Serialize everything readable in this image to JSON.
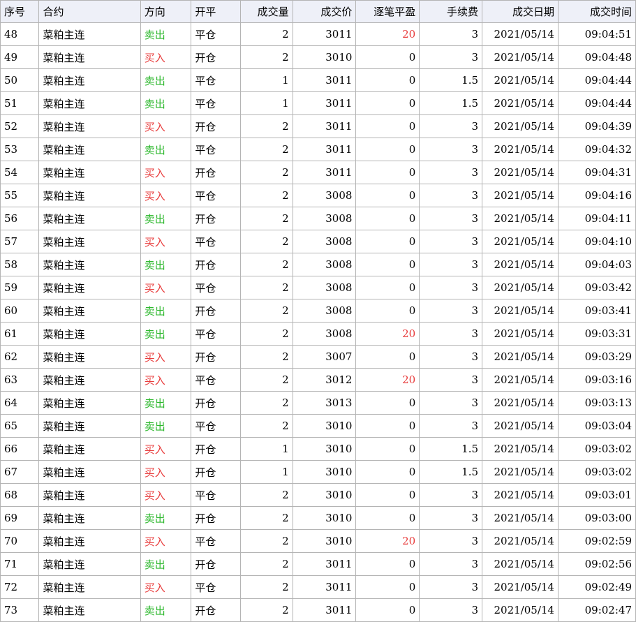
{
  "headers": [
    "序号",
    "合约",
    "方向",
    "开平",
    "成交量",
    "成交价",
    "逐笔平盈",
    "手续费",
    "成交日期",
    "成交时间"
  ],
  "colors": {
    "sell": "#2db82d",
    "buy": "#e83c3c",
    "profit_positive": "#e83c3c",
    "header_bg": "#eef0f8",
    "grid": "#b4b4b4"
  },
  "rows": [
    {
      "seq": "48",
      "contract": "菜粕主连",
      "direction": "卖出",
      "offset": "平仓",
      "volume": "2",
      "price": "3011",
      "pnl": "20",
      "fee": "3",
      "date": "2021/05/14",
      "time": "09:04:51"
    },
    {
      "seq": "49",
      "contract": "菜粕主连",
      "direction": "买入",
      "offset": "开仓",
      "volume": "2",
      "price": "3010",
      "pnl": "0",
      "fee": "3",
      "date": "2021/05/14",
      "time": "09:04:48"
    },
    {
      "seq": "50",
      "contract": "菜粕主连",
      "direction": "卖出",
      "offset": "平仓",
      "volume": "1",
      "price": "3011",
      "pnl": "0",
      "fee": "1.5",
      "date": "2021/05/14",
      "time": "09:04:44"
    },
    {
      "seq": "51",
      "contract": "菜粕主连",
      "direction": "卖出",
      "offset": "平仓",
      "volume": "1",
      "price": "3011",
      "pnl": "0",
      "fee": "1.5",
      "date": "2021/05/14",
      "time": "09:04:44"
    },
    {
      "seq": "52",
      "contract": "菜粕主连",
      "direction": "买入",
      "offset": "开仓",
      "volume": "2",
      "price": "3011",
      "pnl": "0",
      "fee": "3",
      "date": "2021/05/14",
      "time": "09:04:39"
    },
    {
      "seq": "53",
      "contract": "菜粕主连",
      "direction": "卖出",
      "offset": "平仓",
      "volume": "2",
      "price": "3011",
      "pnl": "0",
      "fee": "3",
      "date": "2021/05/14",
      "time": "09:04:32"
    },
    {
      "seq": "54",
      "contract": "菜粕主连",
      "direction": "买入",
      "offset": "开仓",
      "volume": "2",
      "price": "3011",
      "pnl": "0",
      "fee": "3",
      "date": "2021/05/14",
      "time": "09:04:31"
    },
    {
      "seq": "55",
      "contract": "菜粕主连",
      "direction": "买入",
      "offset": "平仓",
      "volume": "2",
      "price": "3008",
      "pnl": "0",
      "fee": "3",
      "date": "2021/05/14",
      "time": "09:04:16"
    },
    {
      "seq": "56",
      "contract": "菜粕主连",
      "direction": "卖出",
      "offset": "开仓",
      "volume": "2",
      "price": "3008",
      "pnl": "0",
      "fee": "3",
      "date": "2021/05/14",
      "time": "09:04:11"
    },
    {
      "seq": "57",
      "contract": "菜粕主连",
      "direction": "买入",
      "offset": "平仓",
      "volume": "2",
      "price": "3008",
      "pnl": "0",
      "fee": "3",
      "date": "2021/05/14",
      "time": "09:04:10"
    },
    {
      "seq": "58",
      "contract": "菜粕主连",
      "direction": "卖出",
      "offset": "开仓",
      "volume": "2",
      "price": "3008",
      "pnl": "0",
      "fee": "3",
      "date": "2021/05/14",
      "time": "09:04:03"
    },
    {
      "seq": "59",
      "contract": "菜粕主连",
      "direction": "买入",
      "offset": "平仓",
      "volume": "2",
      "price": "3008",
      "pnl": "0",
      "fee": "3",
      "date": "2021/05/14",
      "time": "09:03:42"
    },
    {
      "seq": "60",
      "contract": "菜粕主连",
      "direction": "卖出",
      "offset": "开仓",
      "volume": "2",
      "price": "3008",
      "pnl": "0",
      "fee": "3",
      "date": "2021/05/14",
      "time": "09:03:41"
    },
    {
      "seq": "61",
      "contract": "菜粕主连",
      "direction": "卖出",
      "offset": "平仓",
      "volume": "2",
      "price": "3008",
      "pnl": "20",
      "fee": "3",
      "date": "2021/05/14",
      "time": "09:03:31"
    },
    {
      "seq": "62",
      "contract": "菜粕主连",
      "direction": "买入",
      "offset": "开仓",
      "volume": "2",
      "price": "3007",
      "pnl": "0",
      "fee": "3",
      "date": "2021/05/14",
      "time": "09:03:29"
    },
    {
      "seq": "63",
      "contract": "菜粕主连",
      "direction": "买入",
      "offset": "平仓",
      "volume": "2",
      "price": "3012",
      "pnl": "20",
      "fee": "3",
      "date": "2021/05/14",
      "time": "09:03:16"
    },
    {
      "seq": "64",
      "contract": "菜粕主连",
      "direction": "卖出",
      "offset": "开仓",
      "volume": "2",
      "price": "3013",
      "pnl": "0",
      "fee": "3",
      "date": "2021/05/14",
      "time": "09:03:13"
    },
    {
      "seq": "65",
      "contract": "菜粕主连",
      "direction": "卖出",
      "offset": "平仓",
      "volume": "2",
      "price": "3010",
      "pnl": "0",
      "fee": "3",
      "date": "2021/05/14",
      "time": "09:03:04"
    },
    {
      "seq": "66",
      "contract": "菜粕主连",
      "direction": "买入",
      "offset": "开仓",
      "volume": "1",
      "price": "3010",
      "pnl": "0",
      "fee": "1.5",
      "date": "2021/05/14",
      "time": "09:03:02"
    },
    {
      "seq": "67",
      "contract": "菜粕主连",
      "direction": "买入",
      "offset": "开仓",
      "volume": "1",
      "price": "3010",
      "pnl": "0",
      "fee": "1.5",
      "date": "2021/05/14",
      "time": "09:03:02"
    },
    {
      "seq": "68",
      "contract": "菜粕主连",
      "direction": "买入",
      "offset": "平仓",
      "volume": "2",
      "price": "3010",
      "pnl": "0",
      "fee": "3",
      "date": "2021/05/14",
      "time": "09:03:01"
    },
    {
      "seq": "69",
      "contract": "菜粕主连",
      "direction": "卖出",
      "offset": "开仓",
      "volume": "2",
      "price": "3010",
      "pnl": "0",
      "fee": "3",
      "date": "2021/05/14",
      "time": "09:03:00"
    },
    {
      "seq": "70",
      "contract": "菜粕主连",
      "direction": "买入",
      "offset": "平仓",
      "volume": "2",
      "price": "3010",
      "pnl": "20",
      "fee": "3",
      "date": "2021/05/14",
      "time": "09:02:59"
    },
    {
      "seq": "71",
      "contract": "菜粕主连",
      "direction": "卖出",
      "offset": "开仓",
      "volume": "2",
      "price": "3011",
      "pnl": "0",
      "fee": "3",
      "date": "2021/05/14",
      "time": "09:02:56"
    },
    {
      "seq": "72",
      "contract": "菜粕主连",
      "direction": "买入",
      "offset": "平仓",
      "volume": "2",
      "price": "3011",
      "pnl": "0",
      "fee": "3",
      "date": "2021/05/14",
      "time": "09:02:49"
    },
    {
      "seq": "73",
      "contract": "菜粕主连",
      "direction": "卖出",
      "offset": "开仓",
      "volume": "2",
      "price": "3011",
      "pnl": "0",
      "fee": "3",
      "date": "2021/05/14",
      "time": "09:02:47"
    }
  ]
}
